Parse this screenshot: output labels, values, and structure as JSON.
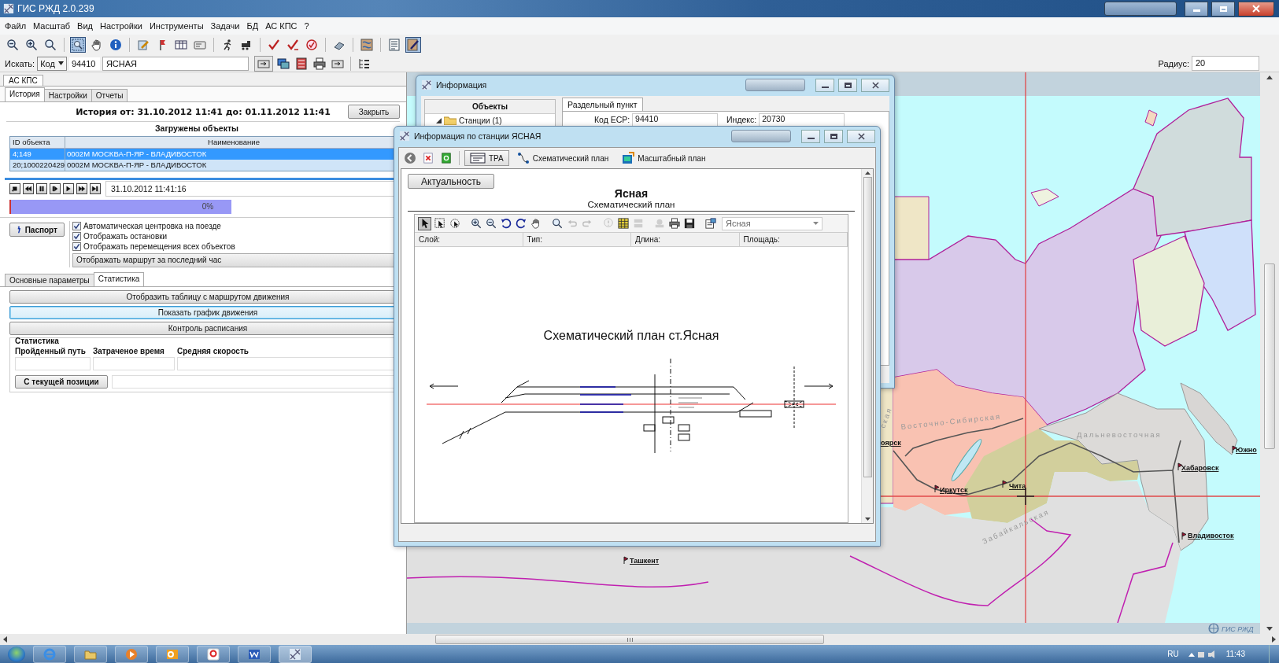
{
  "window": {
    "title": "ГИС РЖД 2.0.239"
  },
  "menu": [
    "Файл",
    "Масштаб",
    "Вид",
    "Настройки",
    "Инструменты",
    "Задачи",
    "БД",
    "АС КПС",
    "?"
  ],
  "toolbar": [
    {
      "kind": "zoom-out",
      "selected": false
    },
    {
      "kind": "zoom-in",
      "selected": false
    },
    {
      "kind": "magnifier",
      "selected": false
    },
    {
      "kind": "zoom-box",
      "selected": true
    },
    {
      "kind": "hand",
      "selected": false
    },
    {
      "kind": "info",
      "selected": false
    },
    {
      "kind": "pencil-sheet",
      "selected": false
    },
    {
      "kind": "flag",
      "selected": false
    },
    {
      "kind": "table",
      "selected": false
    },
    {
      "kind": "card",
      "selected": false
    },
    {
      "kind": "runner",
      "selected": false
    },
    {
      "kind": "locomotive",
      "selected": false
    },
    {
      "kind": "check",
      "selected": false
    },
    {
      "kind": "check-minus",
      "selected": false
    },
    {
      "kind": "circle-check",
      "selected": false
    },
    {
      "kind": "eraser",
      "selected": false
    },
    {
      "kind": "map",
      "selected": false
    },
    {
      "kind": "document",
      "selected": false
    },
    {
      "kind": "map-pencil",
      "selected": true
    }
  ],
  "search": {
    "label": "Искать:",
    "mode": "Код",
    "code": "94410",
    "name": "ЯСНАЯ",
    "radius_label": "Радиус:",
    "radius": "20"
  },
  "left_panel": {
    "tab": "АС КПС",
    "tabs": [
      {
        "label": "История",
        "selected": true
      },
      {
        "label": "Настройки",
        "selected": false
      },
      {
        "label": "Отчеты",
        "selected": false
      }
    ],
    "history_title": "История от: 31.10.2012 11:41 до: 01.11.2012 11:41",
    "close_button": "Закрыть",
    "loaded_title": "Загружены объекты",
    "table": {
      "columns": [
        "ID объекта",
        "Наименование"
      ],
      "rows": [
        {
          "id": "4;149",
          "name": "0002М МОСКВА-П-ЯР - ВЛАДИВОСТОК",
          "selected": true
        },
        {
          "id": "20;1000220429",
          "name": "0002М МОСКВА-П-ЯР - ВЛАДИВОСТОК",
          "selected": false
        }
      ]
    },
    "playback_time": "31.10.2012 11:41:16",
    "progress": {
      "level": 0.56,
      "label": "0%"
    },
    "passport_button": "Паспорт",
    "options": [
      {
        "label": "Автоматическая центровка на поезде",
        "checked": true
      },
      {
        "label": "Отображать остановки",
        "checked": true
      },
      {
        "label": "Отображать перемещения всех объектов",
        "checked": true
      }
    ],
    "route_option": "Отображать маршрут за последний час",
    "subtabs": [
      {
        "label": "Основные параметры",
        "selected": false
      },
      {
        "label": "Статистика",
        "selected": true
      }
    ],
    "actions": [
      {
        "label": "Отобразить таблицу с маршрутом движения",
        "focused": false
      },
      {
        "label": "Показать график движения",
        "focused": true
      },
      {
        "label": "Контроль расписания",
        "focused": false
      }
    ],
    "stats": {
      "title": "Статистика",
      "fields": [
        "Пройденный путь",
        "Затраченое время",
        "Средняя скорость"
      ]
    },
    "position_button": "С текущей позиции"
  },
  "map": {
    "cities": [
      "Иркутск",
      "Чита",
      "Хабаровск",
      "Владивосток",
      "Южно",
      "оярск",
      "Ташкент"
    ],
    "regions": [
      "Дальневосточная",
      "Восточно-Сибирская",
      "Забайкальская",
      "ская"
    ],
    "logo": "ГИС РЖД"
  },
  "info_window": {
    "title": "Информация",
    "objects_header": "Объекты",
    "tree": [
      {
        "label": "Станции (1)",
        "expanded": true
      }
    ],
    "tab": "Раздельный пункт",
    "fields": [
      {
        "label": "Код ЕСР:",
        "value": "94410"
      },
      {
        "label": "Индекс:",
        "value": "20730"
      }
    ]
  },
  "station_window": {
    "title": "Информация по станции ЯСНАЯ",
    "views": [
      {
        "label": "ТРА",
        "kind": "tra",
        "selected": true
      },
      {
        "label": "Схематический план",
        "kind": "scheme",
        "selected": false
      },
      {
        "label": "Масштабный план",
        "kind": "scale",
        "selected": false
      }
    ],
    "actuality_button": "Актуальность",
    "station": "Ясная",
    "subtitle": "Схематический план",
    "tools": [
      {
        "kind": "pointer",
        "selected": true,
        "disabled": false
      },
      {
        "kind": "select-box",
        "selected": false,
        "disabled": false
      },
      {
        "kind": "lasso",
        "selected": false,
        "disabled": false
      },
      {
        "kind": "zoom-in",
        "selected": false,
        "disabled": false
      },
      {
        "kind": "zoom-out",
        "selected": false,
        "disabled": false
      },
      {
        "kind": "rotate-left",
        "selected": false,
        "disabled": false
      },
      {
        "kind": "rotate-right",
        "selected": false,
        "disabled": false
      },
      {
        "kind": "hand",
        "selected": false,
        "disabled": false
      },
      {
        "kind": "magnifier",
        "selected": false,
        "disabled": false
      },
      {
        "kind": "undo",
        "selected": false,
        "disabled": true
      },
      {
        "kind": "redo",
        "selected": false,
        "disabled": true
      },
      {
        "kind": "bubble",
        "selected": false,
        "disabled": true
      },
      {
        "kind": "grid",
        "selected": false,
        "disabled": false
      },
      {
        "kind": "stack",
        "selected": false,
        "disabled": true
      },
      {
        "kind": "stamp",
        "selected": false,
        "disabled": true
      },
      {
        "kind": "printer",
        "selected": false,
        "disabled": false
      },
      {
        "kind": "floppy",
        "selected": false,
        "disabled": false
      },
      {
        "kind": "properties",
        "selected": false,
        "disabled": false
      }
    ],
    "layer_select": "Ясная",
    "columns": [
      "Слой:",
      "Тип:",
      "Длина:",
      "Площадь:"
    ],
    "plan_title": "Схематический план ст.Ясная"
  },
  "taskbar": {
    "language": "RU",
    "time": "11:43"
  }
}
